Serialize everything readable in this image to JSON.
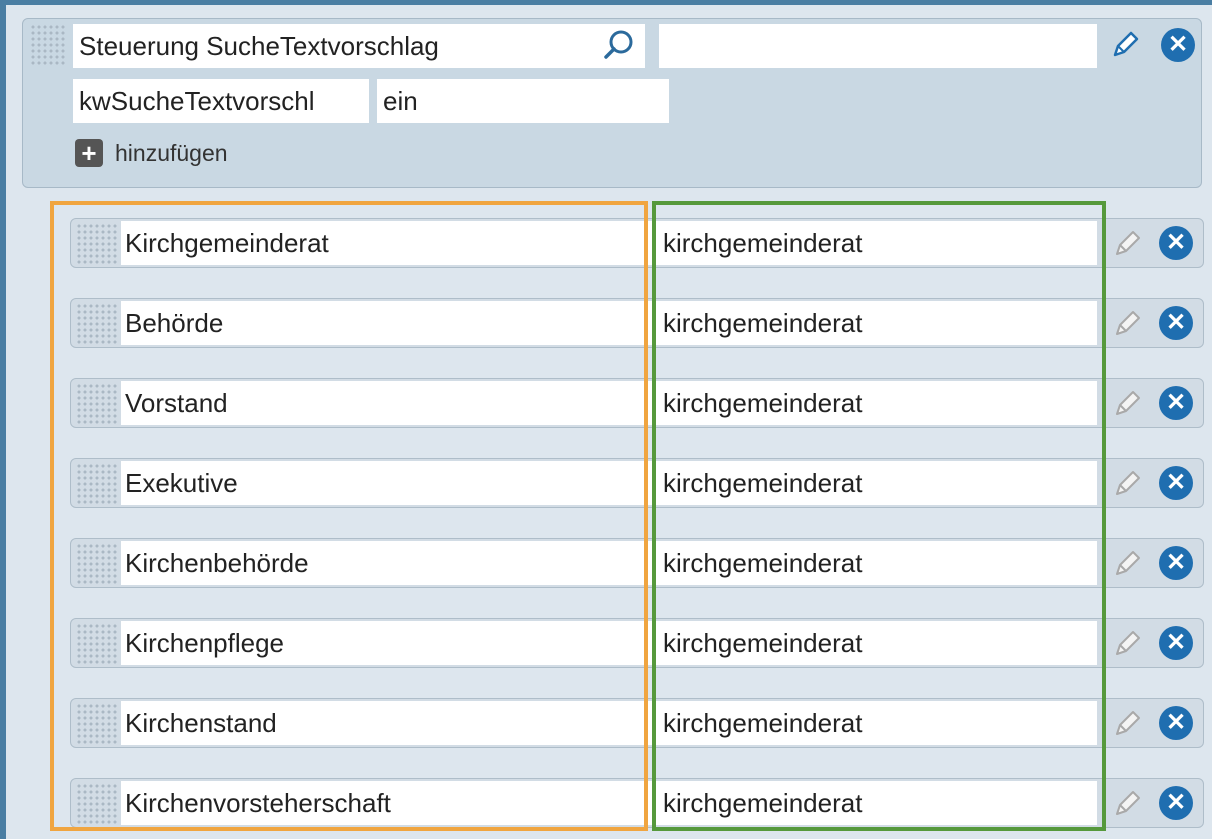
{
  "header": {
    "search_value": "Steuerung SucheTextvorschlag",
    "right_value": "",
    "key_value": "kwSucheTextvorschl",
    "key_state": "ein",
    "add_label": "hinzufügen"
  },
  "rows": [
    {
      "label": "Kirchgemeinderat",
      "target": "kirchgemeinderat"
    },
    {
      "label": "Behörde",
      "target": "kirchgemeinderat"
    },
    {
      "label": "Vorstand",
      "target": "kirchgemeinderat"
    },
    {
      "label": "Exekutive",
      "target": "kirchgemeinderat"
    },
    {
      "label": "Kirchenbehörde",
      "target": "kirchgemeinderat"
    },
    {
      "label": "Kirchenpflege",
      "target": "kirchgemeinderat"
    },
    {
      "label": "Kirchenstand",
      "target": "kirchgemeinderat"
    },
    {
      "label": "Kirchenvorsteherschaft",
      "target": "kirchgemeinderat"
    }
  ],
  "icons": {
    "search": "search-icon",
    "edit": "pencil-icon",
    "remove": "close-icon",
    "add": "plus-icon",
    "drag": "drag-handle-icon"
  },
  "colors": {
    "accent_blue": "#1f6eb0",
    "highlight_orange": "#f0a540",
    "highlight_green": "#56993c",
    "frame_blue": "#4a7ea3"
  }
}
